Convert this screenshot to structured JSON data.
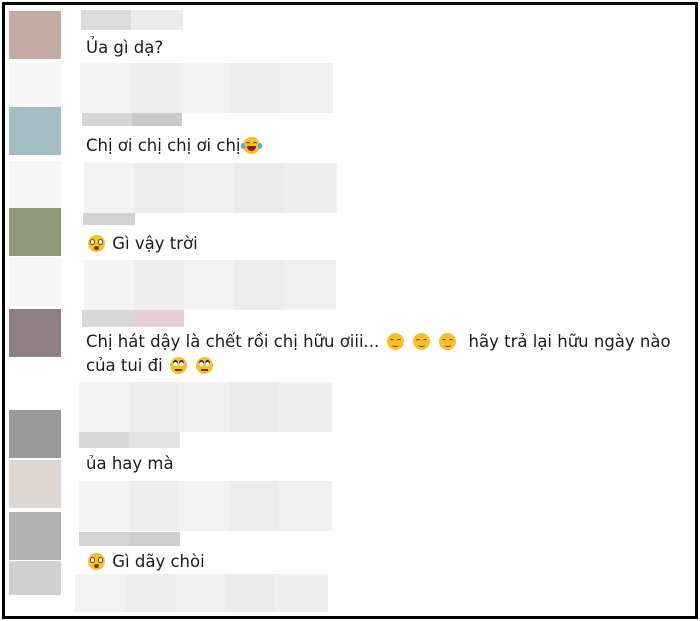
{
  "comments": [
    {
      "text": "Ủa gì dạ?",
      "emojis_before": [],
      "emojis_after": []
    },
    {
      "text": "Chị ơi chị chị ơi chị",
      "emojis_before": [],
      "emojis_after": [
        "laughing-tears-emoji"
      ]
    },
    {
      "text": "Gì vậy trời",
      "emojis_before": [
        "shocked-face-emoji"
      ],
      "emojis_after": []
    },
    {
      "text_line1": "Chị hát dậy là chết rồi chị hữu ơiii...",
      "mid_emojis": [
        "relieved-face-emoji",
        "relieved-face-emoji",
        "relieved-face-emoji"
      ],
      "text_line1b": "hãy trả lại hữu ngày nào",
      "text_line2": "của tui đi",
      "line2_emojis": [
        "rolling-eyes-emoji",
        "rolling-eyes-emoji"
      ]
    },
    {
      "text": "ủa hay mà",
      "emojis_before": [],
      "emojis_after": []
    },
    {
      "text": "Gì dãy chòi",
      "emojis_before": [
        "shocked-face-emoji"
      ],
      "emojis_after": []
    }
  ]
}
